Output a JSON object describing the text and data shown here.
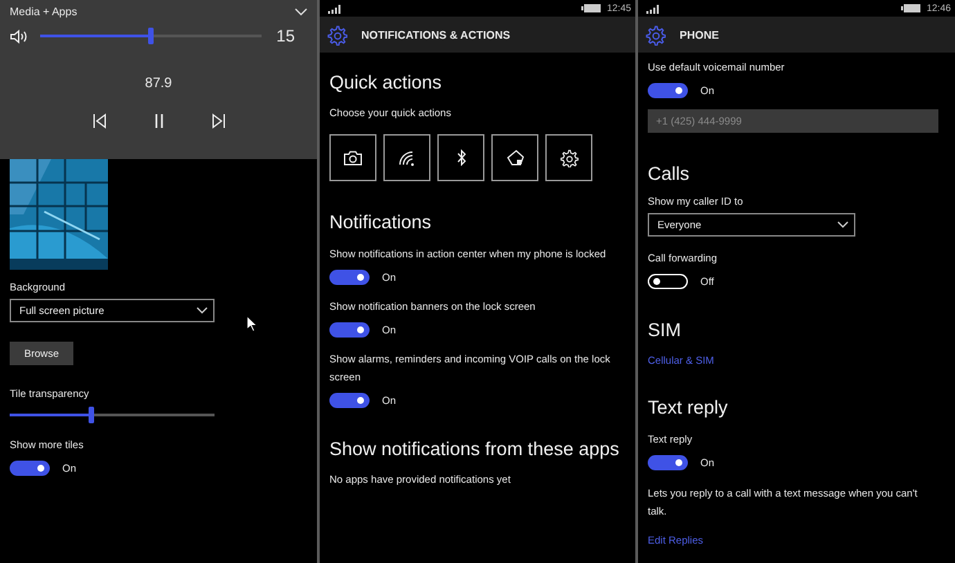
{
  "panels": [
    {
      "kind": "start",
      "overlay": {
        "title": "Media + Apps",
        "volume": {
          "level": 0.5,
          "reading": "15"
        },
        "station": "87.9"
      },
      "items": [
        {
          "kind": "picture"
        },
        {
          "kind": "label",
          "text": "Background"
        },
        {
          "kind": "dropdown",
          "value": "Full screen picture"
        },
        {
          "kind": "button",
          "label": "Browse"
        },
        {
          "kind": "slider",
          "label": "Tile transparency",
          "level": 0.4
        },
        {
          "kind": "toggle",
          "label": "Show more tiles",
          "on": true,
          "state_text": "On"
        }
      ]
    },
    {
      "kind": "settings",
      "status": {
        "time": "12:45"
      },
      "title": "NOTIFICATIONS & ACTIONS",
      "items": [
        {
          "kind": "heading",
          "text": "Quick actions"
        },
        {
          "kind": "label",
          "text": "Choose your quick actions"
        },
        {
          "kind": "quick_actions"
        },
        {
          "kind": "heading",
          "text": "Notifications"
        },
        {
          "kind": "toggle",
          "label": "Show notifications in action center when my phone is locked",
          "on": true,
          "state_text": "On"
        },
        {
          "kind": "toggle",
          "label": "Show notification banners on the lock screen",
          "on": true,
          "state_text": "On"
        },
        {
          "kind": "toggle",
          "label": "Show alarms, reminders and incoming VOIP calls on the lock screen",
          "on": true,
          "state_text": "On"
        },
        {
          "kind": "heading",
          "text": "Show notifications from these apps"
        },
        {
          "kind": "label",
          "text": "No apps have provided notifications yet"
        }
      ]
    },
    {
      "kind": "settings",
      "status": {
        "time": "12:46"
      },
      "title": "PHONE",
      "items": [
        {
          "kind": "toggle",
          "label": "Use default voicemail number",
          "on": true,
          "state_text": "On"
        },
        {
          "kind": "field",
          "placeholder": "+1 (425) 444-9999"
        },
        {
          "kind": "heading",
          "text": "Calls"
        },
        {
          "kind": "label",
          "text": "Show my caller ID to"
        },
        {
          "kind": "dropdown",
          "value": "Everyone"
        },
        {
          "kind": "toggle",
          "label": "Call forwarding",
          "on": false,
          "state_text": "Off"
        },
        {
          "kind": "heading",
          "text": "SIM"
        },
        {
          "kind": "link",
          "text": "Cellular & SIM"
        },
        {
          "kind": "heading",
          "text": "Text reply"
        },
        {
          "kind": "toggle",
          "label": "Text reply",
          "on": true,
          "state_text": "On"
        },
        {
          "kind": "text",
          "text": "Lets you reply to a call with a text message when you can't talk."
        },
        {
          "kind": "link",
          "text": "Edit Replies"
        }
      ]
    }
  ]
}
